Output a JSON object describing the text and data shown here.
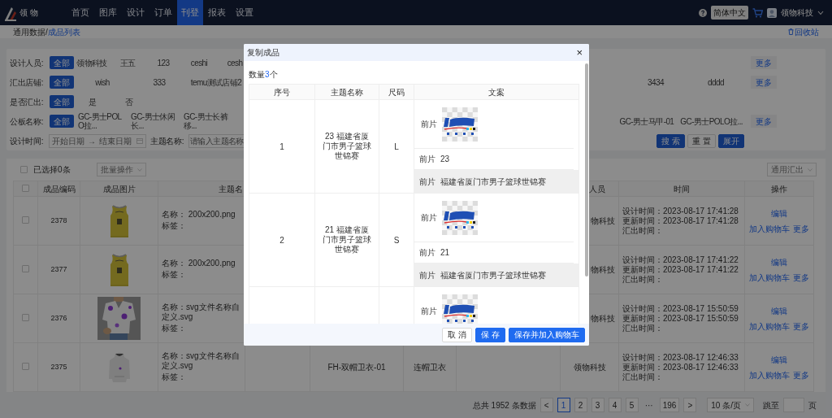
{
  "nav": {
    "logo": "领 物",
    "items": [
      {
        "label": "首页",
        "selected": false
      },
      {
        "label": "图库",
        "selected": false
      },
      {
        "label": "设计",
        "selected": false
      },
      {
        "label": "订单",
        "selected": false
      },
      {
        "label": "刊登",
        "selected": true
      },
      {
        "label": "报表",
        "selected": false
      },
      {
        "label": "设置",
        "selected": false
      }
    ],
    "language": "简体中文",
    "user": "领物科技"
  },
  "breadcrumb": {
    "items": [
      {
        "label": "通用数据",
        "selected": false
      },
      {
        "label": "成品列表",
        "selected": true
      }
    ],
    "separator": "/",
    "recycle": "回收站"
  },
  "filters": [
    {
      "label": "设计人员:",
      "options": [
        {
          "label": "全部",
          "selected": true
        },
        {
          "label": "领物科技",
          "selected": false
        },
        {
          "label": "王五",
          "selected": false
        },
        {
          "label": "123",
          "selected": false
        },
        {
          "label": "ceshi",
          "selected": false
        },
        {
          "label": "cesh",
          "selected": false
        }
      ],
      "more": "更多"
    },
    {
      "label": "汇出店铺:",
      "options": [
        {
          "label": "全部",
          "selected": true
        },
        {
          "label": "wish",
          "selected": false
        },
        {
          "label": "333",
          "selected": false
        },
        {
          "label": "temu测试店铺2",
          "selected": false
        }
      ],
      "right_options": [
        {
          "label": "3434",
          "selected": false
        },
        {
          "label": "dddd",
          "selected": false
        }
      ],
      "more": "更多"
    },
    {
      "label": "是否汇出:",
      "options": [
        {
          "label": "全部",
          "selected": true
        },
        {
          "label": "是",
          "selected": false
        },
        {
          "label": "否",
          "selected": false
        }
      ]
    },
    {
      "label": "公板名称:",
      "options": [
        {
          "label": "全部",
          "selected": true
        },
        {
          "label": "GC-男士POLO拉...",
          "selected": false
        },
        {
          "label": "GC-男士休闲长...",
          "selected": false
        },
        {
          "label": "GC-男士长裤移...",
          "selected": false
        }
      ],
      "right_options": [
        {
          "label": "GC-男士马甲-01",
          "selected": false
        },
        {
          "label": "GC-男士POLO拉...",
          "selected": false
        }
      ],
      "more": "更多"
    }
  ],
  "search_row": {
    "date_label": "设计时间:",
    "start_placeholder": "开始日期",
    "arrow": "→",
    "end_placeholder": "结束日期",
    "theme_label": "主题名称:",
    "theme_placeholder": "请输入主题名称",
    "buttons": [
      {
        "label": "搜 索",
        "kind": "primary"
      },
      {
        "label": "重 置",
        "kind": "default"
      },
      {
        "label": "展开",
        "kind": "primary"
      }
    ]
  },
  "table": {
    "toolbar_checked": false,
    "header_checked": false,
    "selected_count": "已选择0条",
    "batch": "批量操作",
    "export": "通用汇出",
    "columns": {
      "code": "成品编码",
      "image": "成品图片",
      "theme": "主题名",
      "designer": "人员",
      "time": "时间",
      "actions": "操作"
    },
    "rows": [
      {
        "checked": false,
        "code": "2378",
        "name_line": "名称：  200x200.png",
        "tag_line": "标签：",
        "designer": "物科技",
        "times": [
          "设计时间：2023-08-17 17:41:28",
          "更新时间：2023-08-17 17:41:28",
          "汇出时间："
        ],
        "edit": "编辑",
        "cart": "加入购物车",
        "more": "更多"
      },
      {
        "checked": false,
        "code": "2377",
        "name_line": "名称：  200x200.png",
        "tag_line": "标签：",
        "designer": "物科技",
        "times": [
          "设计时间：2023-08-17 17:41:22",
          "更新时间：2023-08-17 17:41:22",
          "汇出时间："
        ],
        "edit": "编辑",
        "cart": "加入购物车",
        "more": "更多"
      },
      {
        "checked": false,
        "code": "2376",
        "name_line": "名称：svg文件名称自定义.svg",
        "tag_line": "标签：",
        "designer": "物科技",
        "times": [
          "设计时间：2023-08-17 15:50:59",
          "更新时间：2023-08-17 15:50:59",
          "汇出时间："
        ],
        "edit": "编辑",
        "cart": "加入购物车",
        "more": "更多"
      },
      {
        "checked": false,
        "code": "2375",
        "name_line": "名称：svg文件名称自定义.svg",
        "tag_line": "标签：",
        "column_5": "FH-双帽卫衣-01",
        "column_6": "连帽卫衣",
        "designer": "领物科技",
        "times": [
          "设计时间：2023-08-17 12:46:33",
          "更新时间：2023-08-17 12:46:33",
          "汇出时间："
        ],
        "edit": "编辑",
        "cart": "加入购物车",
        "more": "更多"
      }
    ]
  },
  "pagination": {
    "total": "总共 1952 条数据",
    "prev": "<",
    "next": ">",
    "pages": [
      {
        "label": "1",
        "selected": true
      },
      {
        "label": "2",
        "selected": false
      },
      {
        "label": "3",
        "selected": false
      },
      {
        "label": "4",
        "selected": false
      },
      {
        "label": "5",
        "selected": false
      },
      {
        "label": "···",
        "selected": false,
        "kind": "ellipsis"
      },
      {
        "label": "196",
        "selected": false
      }
    ],
    "page_size": "10 条/页",
    "jump_label": "跳至",
    "jump_suffix": "页"
  },
  "dialog": {
    "title": "复制成品",
    "close": "×",
    "count_prefix": "数量",
    "count": "3",
    "count_suffix": "个",
    "columns": [
      "序号",
      "主题名称",
      "尺码",
      "文案"
    ],
    "rows": [
      {
        "index": "1",
        "theme": "23 福建省厦门市男子篮球世锦赛",
        "size": "L",
        "copy": [
          {
            "label": "前片"
          },
          {
            "kind": "text",
            "label": "前片",
            "value": "23"
          },
          {
            "kind": "title",
            "label": "前片",
            "value": "福建省厦门市男子篮球世锦赛"
          }
        ]
      },
      {
        "index": "2",
        "theme": "21 福建省厦门市男子篮球世锦赛",
        "size": "S",
        "copy": [
          {
            "label": "前片"
          },
          {
            "kind": "text",
            "label": "前片",
            "value": "21"
          },
          {
            "kind": "title",
            "label": "前片",
            "value": "福建省厦门市男子篮球世锦赛"
          }
        ]
      },
      {
        "copy": [
          {
            "label": "前片"
          }
        ]
      }
    ],
    "buttons": [
      {
        "label": "取 消",
        "kind": "default"
      },
      {
        "label": "保 存",
        "kind": "primary"
      },
      {
        "label": "保存并加入购物车",
        "kind": "primary"
      }
    ]
  }
}
